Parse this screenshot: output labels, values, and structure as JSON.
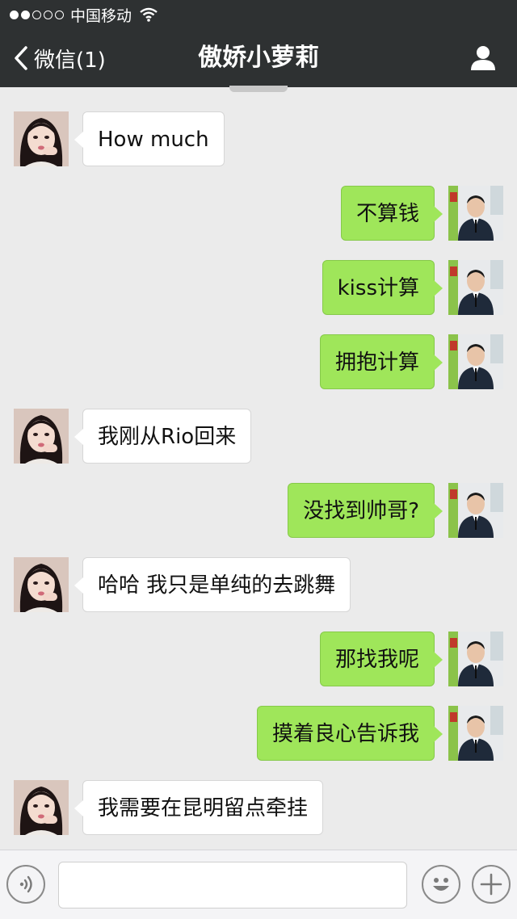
{
  "status_bar": {
    "signal_filled": 2,
    "signal_total": 5,
    "carrier": "中国移动",
    "icons": [
      "wifi-icon"
    ]
  },
  "nav": {
    "back_label": "微信(1)",
    "title": "傲娇小萝莉",
    "icons": [
      "chevron-left-icon",
      "profile-icon"
    ]
  },
  "messages": [
    {
      "side": "left",
      "text": "How much"
    },
    {
      "side": "right",
      "text": "不算钱"
    },
    {
      "side": "right",
      "text": "kiss计算"
    },
    {
      "side": "right",
      "text": "拥抱计算"
    },
    {
      "side": "left",
      "text": "我刚从Rio回来"
    },
    {
      "side": "right",
      "text": "没找到帅哥?"
    },
    {
      "side": "left",
      "text": "哈哈 我只是单纯的去跳舞"
    },
    {
      "side": "right",
      "text": "那找我呢"
    },
    {
      "side": "right",
      "text": "摸着良心告诉我"
    },
    {
      "side": "left",
      "text": "我需要在昆明留点牵挂"
    }
  ],
  "input_bar": {
    "value": "",
    "icons": [
      "voice-icon",
      "emoji-icon",
      "plus-icon"
    ]
  },
  "colors": {
    "nav_bg": "#2e3132",
    "chat_bg": "#ebebeb",
    "sent_bubble": "#9fe65a",
    "received_bubble": "#ffffff"
  }
}
